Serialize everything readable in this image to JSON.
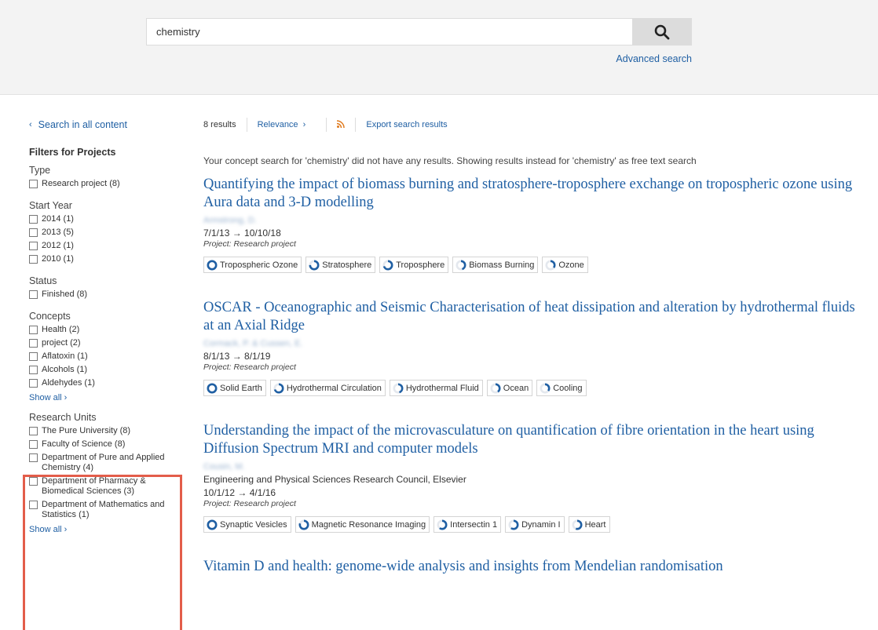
{
  "search": {
    "query": "chemistry",
    "advanced_label": "Advanced search"
  },
  "colors": {
    "link": "#1f5fa3",
    "ring": "#1f5fa3",
    "highlight": "#e35d4a",
    "rss": "#e07b1f"
  },
  "sidebar": {
    "back_label": "Search in all content",
    "filters_title": "Filters for Projects",
    "facets": [
      {
        "title": "Type",
        "options": [
          "Research project (8)"
        ],
        "show_all": ""
      },
      {
        "title": "Start Year",
        "options": [
          "2014 (1)",
          "2013 (5)",
          "2012 (1)",
          "2010 (1)"
        ],
        "show_all": ""
      },
      {
        "title": "Status",
        "options": [
          "Finished (8)"
        ],
        "show_all": ""
      },
      {
        "title": "Concepts",
        "options": [
          "Health (2)",
          "project (2)",
          "Aflatoxin (1)",
          "Alcohols (1)",
          "Aldehydes (1)"
        ],
        "show_all": "Show all ›"
      },
      {
        "title": "Research Units",
        "options": [
          "The Pure University (8)",
          "Faculty of Science (8)",
          "Department of Pure and Applied Chemistry (4)",
          "Department of Pharmacy & Biomedical Sciences (3)",
          "Department of Mathematics and Statistics (1)"
        ],
        "show_all": "Show all ›"
      }
    ]
  },
  "toolbar": {
    "count": "8 results",
    "sort": "Relevance",
    "export": "Export search results"
  },
  "notice": "Your concept search for 'chemistry' did not have any results. Showing results instead for 'chemistry' as free text search",
  "results": [
    {
      "title": "Quantifying the impact of biomass burning and stratosphere-troposphere exchange on tropospheric ozone using Aura data and 3-D modelling",
      "authors": "Armstrong, D.",
      "funder": "",
      "date": "7/1/13 → 10/10/18",
      "type": "Project: Research project",
      "tags": [
        {
          "label": "Tropospheric Ozone",
          "weight": 1.0
        },
        {
          "label": "Stratosphere",
          "weight": 0.75
        },
        {
          "label": "Troposphere",
          "weight": 0.7
        },
        {
          "label": "Biomass Burning",
          "weight": 0.45
        },
        {
          "label": "Ozone",
          "weight": 0.35
        }
      ]
    },
    {
      "title": "OSCAR - Oceanographic and Seismic Characterisation of heat dissipation and alteration by hydrothermal fluids at an Axial Ridge",
      "authors": "Cormack, P. & Cussen, E.",
      "funder": "",
      "date": "8/1/13 → 8/1/19",
      "type": "Project: Research project",
      "tags": [
        {
          "label": "Solid Earth",
          "weight": 1.0
        },
        {
          "label": "Hydrothermal Circulation",
          "weight": 0.7
        },
        {
          "label": "Hydrothermal Fluid",
          "weight": 0.45
        },
        {
          "label": "Ocean",
          "weight": 0.4
        },
        {
          "label": "Cooling",
          "weight": 0.35
        }
      ]
    },
    {
      "title": "Understanding the impact of the microvasculature on quantification of fibre orientation in the heart using Diffusion Spectrum MRI and computer models",
      "authors": "Cousin, M.",
      "funder": "Engineering and Physical Sciences Research Council, Elsevier",
      "date": "10/1/12 → 4/1/16",
      "type": "Project: Research project",
      "tags": [
        {
          "label": "Synaptic Vesicles",
          "weight": 1.0
        },
        {
          "label": "Magnetic Resonance Imaging",
          "weight": 0.8
        },
        {
          "label": "Intersectin 1",
          "weight": 0.6
        },
        {
          "label": "Dynamin I",
          "weight": 0.6
        },
        {
          "label": "Heart",
          "weight": 0.55
        }
      ]
    },
    {
      "title": "Vitamin D and health: genome-wide analysis and insights from Mendelian randomisation",
      "authors": "",
      "funder": "",
      "date": "",
      "type": "",
      "tags": []
    }
  ]
}
